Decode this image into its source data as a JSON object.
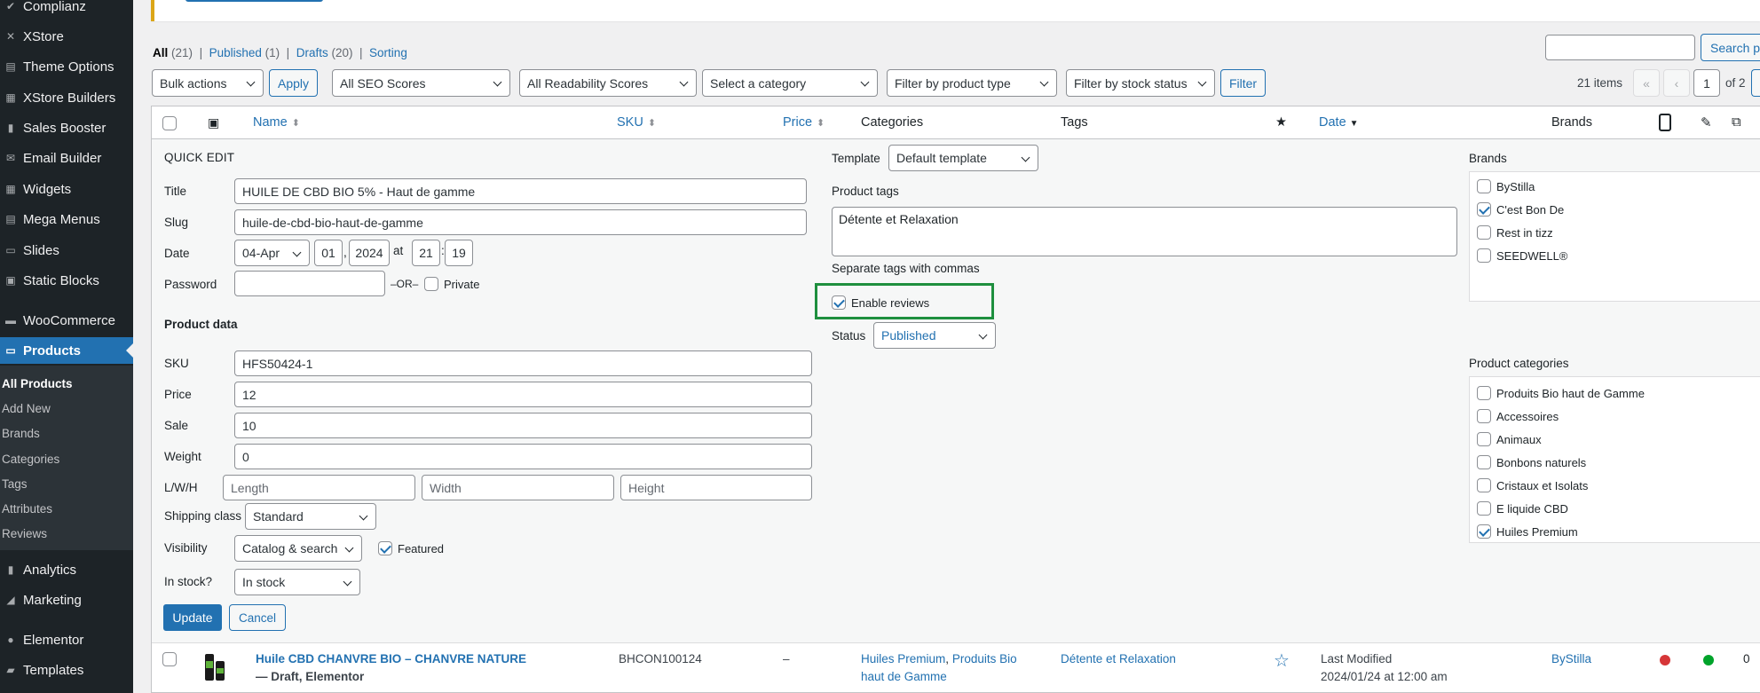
{
  "sidebar": {
    "items": [
      {
        "label": "Complianz",
        "icon": "check-icon"
      },
      {
        "label": "XStore",
        "icon": "x-icon"
      },
      {
        "label": "Theme Options",
        "icon": "settings-icon"
      },
      {
        "label": "XStore Builders",
        "icon": "builder-icon"
      },
      {
        "label": "Sales Booster",
        "icon": "chart-icon"
      },
      {
        "label": "Email Builder",
        "icon": "email-icon"
      },
      {
        "label": "Widgets",
        "icon": "widgets-icon"
      },
      {
        "label": "Mega Menus",
        "icon": "menu-icon"
      },
      {
        "label": "Slides",
        "icon": "slides-icon"
      },
      {
        "label": "Static Blocks",
        "icon": "blocks-icon"
      },
      {
        "label": "WooCommerce",
        "icon": "woo-icon"
      },
      {
        "label": "Products",
        "icon": "products-icon"
      },
      {
        "label": "Analytics",
        "icon": "analytics-icon"
      },
      {
        "label": "Marketing",
        "icon": "marketing-icon"
      },
      {
        "label": "Elementor",
        "icon": "elementor-icon"
      },
      {
        "label": "Templates",
        "icon": "templates-icon"
      }
    ],
    "submenu": [
      "All Products",
      "Add New",
      "Brands",
      "Categories",
      "Tags",
      "Attributes",
      "Reviews"
    ]
  },
  "views": {
    "all": "All",
    "all_count": "(21)",
    "published": "Published",
    "published_count": "(1)",
    "drafts": "Drafts",
    "drafts_count": "(20)",
    "sorting": "Sorting",
    "sep": "|"
  },
  "filters": {
    "bulk_actions": "Bulk actions",
    "apply": "Apply",
    "seo": "All SEO Scores",
    "readability": "All Readability Scores",
    "category": "Select a category",
    "product_type": "Filter by product type",
    "stock_status": "Filter by stock status",
    "filter": "Filter",
    "search_button": "Search pr",
    "items_count": "21 items",
    "first": "«",
    "prev": "‹",
    "page": "1",
    "of_pages": "of 2"
  },
  "columns": {
    "name": "Name",
    "sku": "SKU",
    "price": "Price",
    "categories": "Categories",
    "tags": "Tags",
    "featured": "★",
    "date": "Date",
    "brands": "Brands"
  },
  "quick_edit": {
    "heading": "QUICK EDIT",
    "title_label": "Title",
    "title_value": "HUILE DE CBD BIO 5% - Haut de gamme",
    "slug_label": "Slug",
    "slug_value": "huile-de-cbd-bio-haut-de-gamme",
    "date_label": "Date",
    "month": "04-Apr",
    "day": "01",
    "year": "2024",
    "at": "at",
    "hour": "21",
    "colon": ":",
    "minute": "19",
    "password_label": "Password",
    "or": "–OR–",
    "private": "Private",
    "product_data": "Product data",
    "sku_label": "SKU",
    "sku_value": "HFS50424-1",
    "price_label": "Price",
    "price_value": "12",
    "sale_label": "Sale",
    "sale_value": "10",
    "weight_label": "Weight",
    "weight_value": "0",
    "lwh_label": "L/W/H",
    "length_ph": "Length",
    "width_ph": "Width",
    "height_ph": "Height",
    "shipping_label": "Shipping class",
    "shipping_value": "Standard",
    "visibility_label": "Visibility",
    "visibility_value": "Catalog & search",
    "featured": "Featured",
    "stock_label": "In stock?",
    "stock_value": "In stock",
    "update": "Update",
    "cancel": "Cancel",
    "template_label": "Template",
    "template_value": "Default template",
    "tags_label": "Product tags",
    "tags_value": "Détente et Relaxation",
    "tags_hint": "Separate tags with commas",
    "enable_reviews": "Enable reviews",
    "status_label": "Status",
    "status_value": "Published",
    "brands_heading": "Brands",
    "brands": [
      {
        "label": "ByStilla",
        "checked": false
      },
      {
        "label": "C'est Bon De",
        "checked": true
      },
      {
        "label": "Rest in tizz",
        "checked": false
      },
      {
        "label": "SEEDWELL®",
        "checked": false
      }
    ],
    "categories_heading": "Product categories",
    "categories": [
      {
        "label": "Produits Bio haut de Gamme",
        "checked": false
      },
      {
        "label": "Accessoires",
        "checked": false
      },
      {
        "label": "Animaux",
        "checked": false
      },
      {
        "label": "Bonbons naturels",
        "checked": false
      },
      {
        "label": "Cristaux et Isolats",
        "checked": false
      },
      {
        "label": "E liquide CBD",
        "checked": false
      },
      {
        "label": "Huiles Premium",
        "checked": true
      }
    ]
  },
  "row": {
    "title": "Huile CBD CHANVRE BIO – CHANVRE NATURE",
    "state": "— Draft,",
    "state2": "Elementor",
    "sku": "BHCON100124",
    "price": "–",
    "cat1": "Huiles Premium",
    "comma": ",",
    "cat2": "Produits Bio",
    "cat3": "haut de Gamme",
    "tag": "Détente et Relaxation",
    "date_status": "Last Modified",
    "date_value": "2024/01/24 at 12:00 am",
    "brand": "ByStilla",
    "count": "0"
  },
  "colors": {
    "accent": "#2271b1",
    "highlight": "#1e8f3e",
    "seo_dot": "#d63638",
    "read_dot": "#00a32a"
  }
}
